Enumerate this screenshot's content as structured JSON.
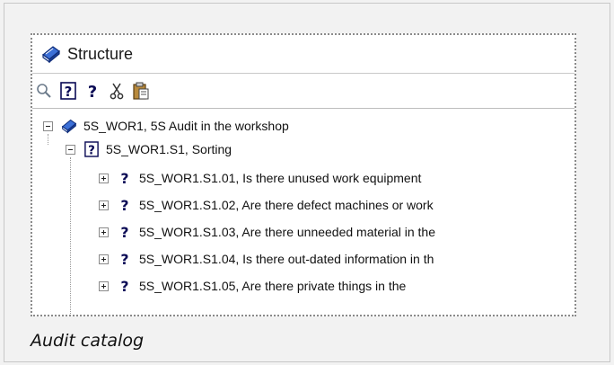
{
  "panel": {
    "title": "Structure"
  },
  "toolbar": {
    "buttons": [
      {
        "name": "search",
        "icon": "magnifier-icon"
      },
      {
        "name": "question-box",
        "icon": "question-box-icon"
      },
      {
        "name": "question",
        "icon": "question-icon"
      },
      {
        "name": "cut",
        "icon": "scissors-icon"
      },
      {
        "name": "paste",
        "icon": "clipboard-icon"
      }
    ]
  },
  "tree": {
    "root": {
      "label": "5S_WOR1, 5S Audit in the workshop",
      "expanded": true,
      "icon": "book-icon"
    },
    "section": {
      "label": "5S_WOR1.S1, Sorting",
      "expanded": true,
      "icon": "question-box-icon"
    },
    "questions": [
      {
        "label": "5S_WOR1.S1.01, Is there unused work equipment"
      },
      {
        "label": "5S_WOR1.S1.02, Are there defect machines or work"
      },
      {
        "label": "5S_WOR1.S1.03, Are there unneeded material in the"
      },
      {
        "label": "5S_WOR1.S1.04, Is there out-dated information in th"
      },
      {
        "label": "5S_WOR1.S1.05, Are there private things in the"
      }
    ]
  },
  "caption": "Audit catalog",
  "colors": {
    "book_blue": "#2f5fc4",
    "question_navy": "#0a0a55",
    "background": "#f2f2f2"
  }
}
